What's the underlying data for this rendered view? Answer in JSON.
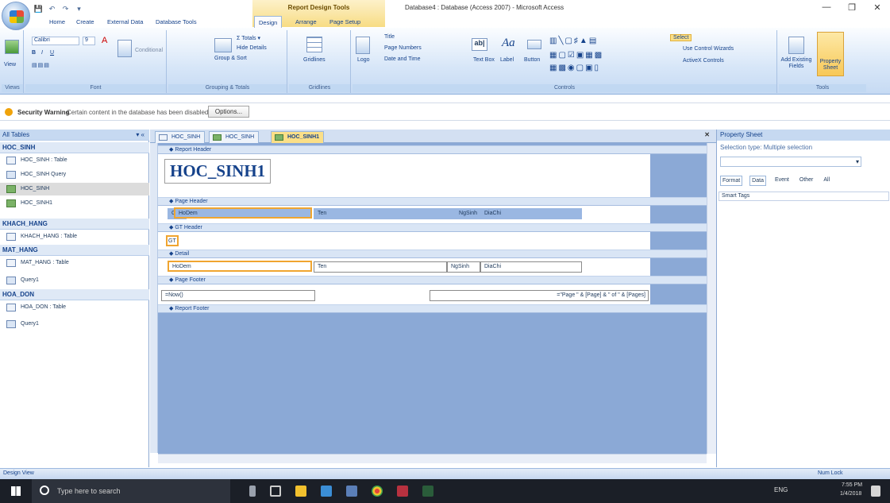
{
  "titlebar": {
    "context_tool": "Report Design Tools",
    "window_title": "Database4 : Database (Access 2007) - Microsoft Access",
    "minimize": "—",
    "maximize": "❐",
    "close": "✕"
  },
  "qat": {
    "save": "💾",
    "undo": "↶",
    "redo": "↷",
    "more": "▾"
  },
  "tabs": [
    "Home",
    "Create",
    "External Data",
    "Database Tools",
    "Design",
    "Arrange",
    "Page Setup"
  ],
  "active_tab": "Design",
  "ribbon": {
    "views": {
      "view": "View",
      "group": "Views"
    },
    "font": {
      "name": "Calibri",
      "size": "9",
      "group": "Font",
      "bold": "B",
      "italic": "I",
      "underline": "U"
    },
    "conditional": "Conditional",
    "grouping": {
      "totals": "Σ Totals ▾",
      "hide_details": "Hide Details",
      "group_sort": "Group & Sort",
      "group": "Grouping & Totals"
    },
    "gridlines": {
      "label": "Gridlines",
      "group": "Gridlines"
    },
    "logo": "Logo",
    "title": "Title",
    "page_numbers": "Page Numbers",
    "date_time": "Date and Time",
    "text_box": "Text Box",
    "label": "Label",
    "button": "Button",
    "select": "Select",
    "control_wizards": "Use Control Wizards",
    "activex": "ActiveX Controls",
    "controls_group": "Controls",
    "add_fields": "Add Existing Fields",
    "property_sheet": "Property Sheet",
    "tools_group": "Tools"
  },
  "security": {
    "label": "Security Warning",
    "message": "Certain content in the database has been disabled",
    "options": "Options..."
  },
  "nav": {
    "header": "All Tables",
    "header_ctl": "▾ «",
    "groups": [
      {
        "name": "HOC_SINH",
        "items": [
          {
            "label": "HOC_SINH : Table",
            "type": "table"
          },
          {
            "label": "HOC_SINH Query",
            "type": "query"
          },
          {
            "label": "HOC_SINH",
            "type": "report",
            "selected": true
          },
          {
            "label": "HOC_SINH1",
            "type": "report"
          }
        ]
      },
      {
        "name": "KHACH_HANG",
        "items": [
          {
            "label": "KHACH_HANG : Table",
            "type": "table"
          }
        ]
      },
      {
        "name": "MAT_HANG",
        "items": [
          {
            "label": "MAT_HANG : Table",
            "type": "table"
          },
          {
            "label": "Query1",
            "type": "query"
          }
        ]
      },
      {
        "name": "HOA_DON",
        "items": [
          {
            "label": "HOA_DON : Table",
            "type": "table"
          },
          {
            "label": "Query1",
            "type": "query"
          }
        ]
      }
    ]
  },
  "doc_tabs": [
    "HOC_SINH",
    "HOC_SINH",
    "HOC_SINH1"
  ],
  "report": {
    "report_header": "Report Header",
    "title": "HOC_SINH1",
    "page_header": "Page Header",
    "ph_gt": "GT",
    "ph_hodem": "HoDem",
    "ph_ten": "Ten",
    "ph_ngsinh": "NgSinh",
    "ph_diachi": "DiaChi",
    "gt_header": "GT Header",
    "gt_field": "GT",
    "detail": "Detail",
    "d_hodem": "HoDem",
    "d_ten": "Ten",
    "d_ngsinh": "NgSinh",
    "d_diachi": "DiaChi",
    "page_footer": "Page Footer",
    "now": "=Now()",
    "pages": "=\"Page \" & [Page] & \" of \" & [Pages]",
    "report_footer": "Report Footer"
  },
  "property_sheet": {
    "title": "Property Sheet",
    "selection": "Selection type:  Multiple selection",
    "tabs": [
      "Format",
      "Data",
      "Event",
      "Other",
      "All"
    ],
    "row": "Smart Tags"
  },
  "status": {
    "left": "Design View",
    "right": "Num Lock"
  },
  "taskbar": {
    "search": "Type here to search",
    "time": "7:55 PM",
    "date": "1/4/2018",
    "lang": "ENG"
  }
}
